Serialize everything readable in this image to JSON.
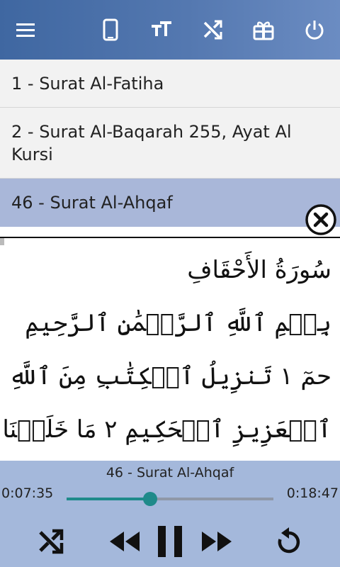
{
  "toolbar": {
    "icons": [
      "menu-icon",
      "phone-icon",
      "text-size-icon",
      "shuffle-icon",
      "gift-icon",
      "power-icon"
    ]
  },
  "list": {
    "items": [
      {
        "label": "1 - Surat Al-Fatiha"
      },
      {
        "label": "2 - Surat Al-Baqarah 255, Ayat Al Kursi"
      },
      {
        "label": "46 - Surat Al-Ahqaf",
        "selected": true
      }
    ]
  },
  "verse": {
    "lines": [
      "سُورَةُ الأَحْقَافِ",
      "بِسۡمِ ٱللَّهِ ٱلرَّحۡمَٰنِ ٱلرَّحِيمِ",
      "حمٓ ١ تَنزِيلُ ٱلۡكِتَٰبِ مِنَ ٱللَّهِ",
      "ٱلۡعَزِيزِ ٱلۡحَكِيمِ ٢ مَا خَلَقۡنَا"
    ]
  },
  "player": {
    "title": "46 - Surat Al-Ahqaf",
    "elapsed": "0:07:35",
    "total": "0:18:47",
    "progress": 0.404,
    "colors": {
      "accent": "#1f8a8a",
      "background": "#a4b8db"
    }
  }
}
